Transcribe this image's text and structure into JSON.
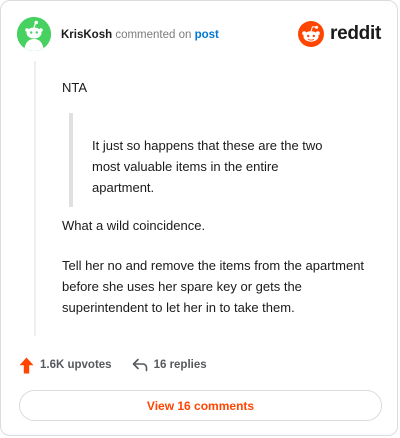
{
  "header": {
    "author": "KrisKosh",
    "action": "commented on",
    "context": "post",
    "brand_name": "reddit",
    "brand_color": "#ff4500",
    "avatar_color": "#46d160",
    "avatar_icon": "snoo-avatar-icon"
  },
  "comment": {
    "p1": "NTA",
    "quote": "It just so happens that these are the two most valuable items in the entire apartment.",
    "p2": "What a wild coincidence.",
    "p3": "Tell her no and remove the items from the apartment before she uses her spare key or gets the superintendent to let her in to take them."
  },
  "footer": {
    "upvotes": "1.6K upvotes",
    "replies": "16 replies",
    "upvote_icon": "upvote-arrow-icon",
    "reply_icon": "reply-arrow-icon",
    "upvote_color": "#ff4500"
  },
  "cta": {
    "label": "View 16 comments"
  }
}
